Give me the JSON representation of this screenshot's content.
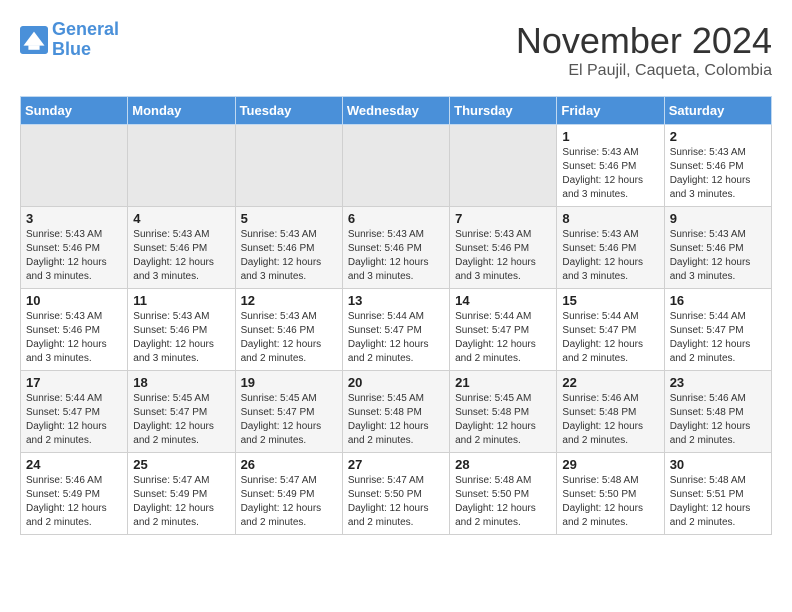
{
  "logo": {
    "text_general": "General",
    "text_blue": "Blue"
  },
  "header": {
    "month": "November 2024",
    "location": "El Paujil, Caqueta, Colombia"
  },
  "days_of_week": [
    "Sunday",
    "Monday",
    "Tuesday",
    "Wednesday",
    "Thursday",
    "Friday",
    "Saturday"
  ],
  "weeks": [
    [
      {
        "day": "",
        "empty": true
      },
      {
        "day": "",
        "empty": true
      },
      {
        "day": "",
        "empty": true
      },
      {
        "day": "",
        "empty": true
      },
      {
        "day": "",
        "empty": true
      },
      {
        "day": "1",
        "sunrise": "5:43 AM",
        "sunset": "5:46 PM",
        "daylight": "12 hours and 3 minutes."
      },
      {
        "day": "2",
        "sunrise": "5:43 AM",
        "sunset": "5:46 PM",
        "daylight": "12 hours and 3 minutes."
      }
    ],
    [
      {
        "day": "3",
        "sunrise": "5:43 AM",
        "sunset": "5:46 PM",
        "daylight": "12 hours and 3 minutes."
      },
      {
        "day": "4",
        "sunrise": "5:43 AM",
        "sunset": "5:46 PM",
        "daylight": "12 hours and 3 minutes."
      },
      {
        "day": "5",
        "sunrise": "5:43 AM",
        "sunset": "5:46 PM",
        "daylight": "12 hours and 3 minutes."
      },
      {
        "day": "6",
        "sunrise": "5:43 AM",
        "sunset": "5:46 PM",
        "daylight": "12 hours and 3 minutes."
      },
      {
        "day": "7",
        "sunrise": "5:43 AM",
        "sunset": "5:46 PM",
        "daylight": "12 hours and 3 minutes."
      },
      {
        "day": "8",
        "sunrise": "5:43 AM",
        "sunset": "5:46 PM",
        "daylight": "12 hours and 3 minutes."
      },
      {
        "day": "9",
        "sunrise": "5:43 AM",
        "sunset": "5:46 PM",
        "daylight": "12 hours and 3 minutes."
      }
    ],
    [
      {
        "day": "10",
        "sunrise": "5:43 AM",
        "sunset": "5:46 PM",
        "daylight": "12 hours and 3 minutes."
      },
      {
        "day": "11",
        "sunrise": "5:43 AM",
        "sunset": "5:46 PM",
        "daylight": "12 hours and 3 minutes."
      },
      {
        "day": "12",
        "sunrise": "5:43 AM",
        "sunset": "5:46 PM",
        "daylight": "12 hours and 2 minutes."
      },
      {
        "day": "13",
        "sunrise": "5:44 AM",
        "sunset": "5:47 PM",
        "daylight": "12 hours and 2 minutes."
      },
      {
        "day": "14",
        "sunrise": "5:44 AM",
        "sunset": "5:47 PM",
        "daylight": "12 hours and 2 minutes."
      },
      {
        "day": "15",
        "sunrise": "5:44 AM",
        "sunset": "5:47 PM",
        "daylight": "12 hours and 2 minutes."
      },
      {
        "day": "16",
        "sunrise": "5:44 AM",
        "sunset": "5:47 PM",
        "daylight": "12 hours and 2 minutes."
      }
    ],
    [
      {
        "day": "17",
        "sunrise": "5:44 AM",
        "sunset": "5:47 PM",
        "daylight": "12 hours and 2 minutes."
      },
      {
        "day": "18",
        "sunrise": "5:45 AM",
        "sunset": "5:47 PM",
        "daylight": "12 hours and 2 minutes."
      },
      {
        "day": "19",
        "sunrise": "5:45 AM",
        "sunset": "5:47 PM",
        "daylight": "12 hours and 2 minutes."
      },
      {
        "day": "20",
        "sunrise": "5:45 AM",
        "sunset": "5:48 PM",
        "daylight": "12 hours and 2 minutes."
      },
      {
        "day": "21",
        "sunrise": "5:45 AM",
        "sunset": "5:48 PM",
        "daylight": "12 hours and 2 minutes."
      },
      {
        "day": "22",
        "sunrise": "5:46 AM",
        "sunset": "5:48 PM",
        "daylight": "12 hours and 2 minutes."
      },
      {
        "day": "23",
        "sunrise": "5:46 AM",
        "sunset": "5:48 PM",
        "daylight": "12 hours and 2 minutes."
      }
    ],
    [
      {
        "day": "24",
        "sunrise": "5:46 AM",
        "sunset": "5:49 PM",
        "daylight": "12 hours and 2 minutes."
      },
      {
        "day": "25",
        "sunrise": "5:47 AM",
        "sunset": "5:49 PM",
        "daylight": "12 hours and 2 minutes."
      },
      {
        "day": "26",
        "sunrise": "5:47 AM",
        "sunset": "5:49 PM",
        "daylight": "12 hours and 2 minutes."
      },
      {
        "day": "27",
        "sunrise": "5:47 AM",
        "sunset": "5:50 PM",
        "daylight": "12 hours and 2 minutes."
      },
      {
        "day": "28",
        "sunrise": "5:48 AM",
        "sunset": "5:50 PM",
        "daylight": "12 hours and 2 minutes."
      },
      {
        "day": "29",
        "sunrise": "5:48 AM",
        "sunset": "5:50 PM",
        "daylight": "12 hours and 2 minutes."
      },
      {
        "day": "30",
        "sunrise": "5:48 AM",
        "sunset": "5:51 PM",
        "daylight": "12 hours and 2 minutes."
      }
    ]
  ],
  "labels": {
    "sunrise": "Sunrise:",
    "sunset": "Sunset:",
    "daylight": "Daylight:"
  },
  "colors": {
    "header_bg": "#4a90d9",
    "odd_row": "#f5f5f5",
    "even_row": "#ffffff",
    "empty_cell": "#e8e8e8"
  }
}
